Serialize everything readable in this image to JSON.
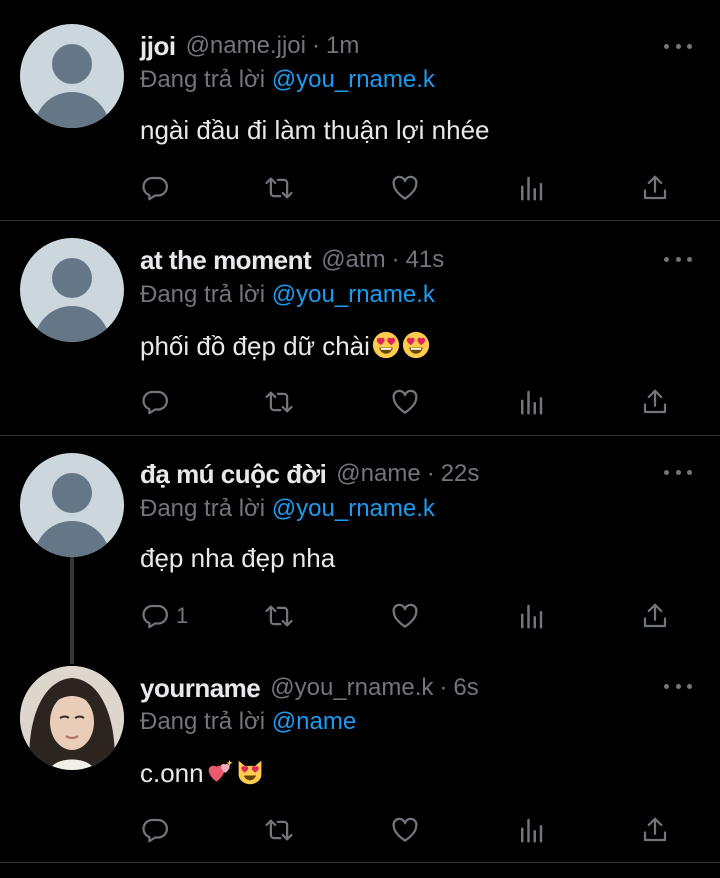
{
  "colors": {
    "background": "#000000",
    "text": "#e7e9ea",
    "muted": "#71767b",
    "accent": "#1d9bf0",
    "divider": "#2f3336"
  },
  "tweets": [
    {
      "name": "jjoi",
      "handle": "@name.jjoi",
      "dot": "·",
      "time": "1m",
      "reply_label": "Đang trả lời",
      "reply_to": "@you_rname.k",
      "text": "ngài đầu đi làm thuận lợi nhée",
      "reply_count": ""
    },
    {
      "name": "at the moment",
      "handle": "@atm",
      "dot": "·",
      "time": "41s",
      "reply_label": "Đang trả lời",
      "reply_to": "@you_rname.k",
      "text": "phối đồ đẹp dữ chài",
      "emojis": [
        "heart-eyes-emoji",
        "heart-eyes-emoji"
      ],
      "reply_count": ""
    },
    {
      "name": "đạ mú cuộc đời",
      "handle": "@name",
      "dot": "·",
      "time": "22s",
      "reply_label": "Đang trả lời",
      "reply_to": "@you_rname.k",
      "text": "đẹp nha đẹp nha",
      "reply_count": "1"
    },
    {
      "name": "yourname",
      "handle": "@you_rname.k",
      "dot": "·",
      "time": "6s",
      "reply_label": "Đang trả lời",
      "reply_to": "@name",
      "text": "c.onn",
      "emojis": [
        "sparkling-heart-emoji",
        "cat-heart-eyes-emoji"
      ],
      "reply_count": ""
    }
  ],
  "action_icons": [
    "reply-icon",
    "retweet-icon",
    "like-icon",
    "views-icon",
    "share-icon"
  ]
}
